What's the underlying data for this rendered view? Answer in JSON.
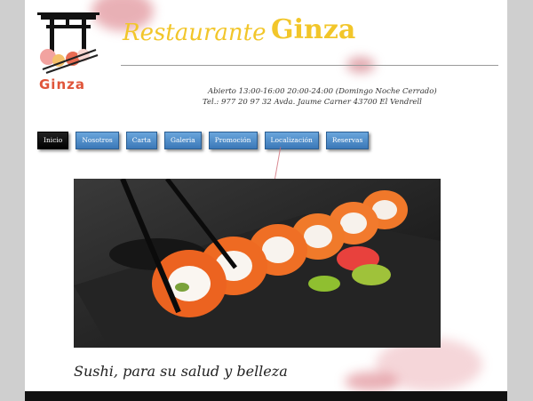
{
  "header": {
    "logo_text": "Ginza",
    "title_script": "Restaurante",
    "title_bold": "Ginza",
    "info_line1": "Abierto  13:00-16:00    20:00-24:00   (Domingo Noche Cerrado)",
    "info_line2": "Tel.: 977 20 97 32          Avda. Jaume Carner      43700       El Vendrell"
  },
  "nav": {
    "items": [
      "Inicio",
      "Nosotros",
      "Carta",
      "Galeria",
      "Promoción",
      "Localización",
      "Reservas"
    ],
    "active": "Inicio"
  },
  "hero": {
    "tagline": "Sushi, para su salud y belleza"
  },
  "colors": {
    "title": "#f2c62a",
    "nav_button": "#3b78b8",
    "nav_active": "#000000",
    "logo_text": "#e0553a"
  }
}
